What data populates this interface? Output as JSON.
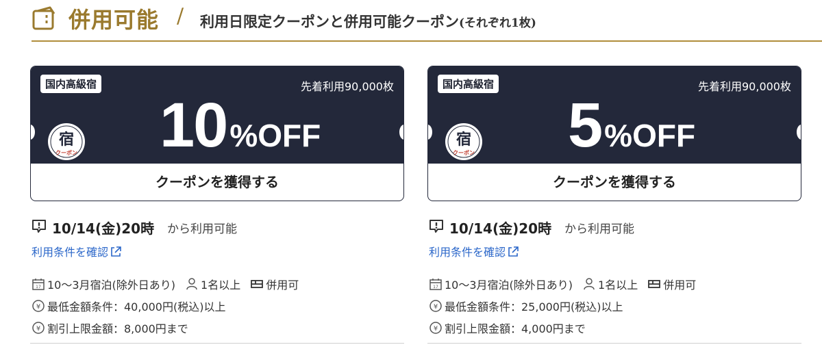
{
  "header": {
    "title": "併用可能",
    "slash": "/",
    "subtitle": "利用日限定クーポンと併用可能クーポン",
    "subtitle_small": "(それぞれ1枚)",
    "accent_color": "#9a7a2e",
    "icon": "ticket-icon"
  },
  "coupons": [
    {
      "badge": "国内高級宿",
      "limit": "先着利用90,000枚",
      "logo_text": "宿",
      "logo_sub": "クーポン",
      "discount_value": "10",
      "discount_unit": "%OFF",
      "button": "クーポンを獲得する",
      "available_date": "10/14(金)20時",
      "available_text": "から利用可能",
      "terms_link": "利用条件を確認",
      "stay_period": "10〜3月宿泊(除外日あり)",
      "guests": "1名以上",
      "combinable": "併用可",
      "min_amount": "最低金額条件：40,000円(税込)以上",
      "max_discount": "割引上限金額：8,000円まで"
    },
    {
      "badge": "国内高級宿",
      "limit": "先着利用90,000枚",
      "logo_text": "宿",
      "logo_sub": "クーポン",
      "discount_value": "5",
      "discount_unit": "%OFF",
      "button": "クーポンを獲得する",
      "available_date": "10/14(金)20時",
      "available_text": "から利用可能",
      "terms_link": "利用条件を確認",
      "stay_period": "10〜3月宿泊(除外日あり)",
      "guests": "1名以上",
      "combinable": "併用可",
      "min_amount": "最低金額条件：25,000円(税込)以上",
      "max_discount": "割引上限金額：4,000円まで"
    }
  ],
  "colors": {
    "ticket_bg": "#23283a",
    "link": "#2a66c9",
    "rule": "#b08d3a"
  }
}
